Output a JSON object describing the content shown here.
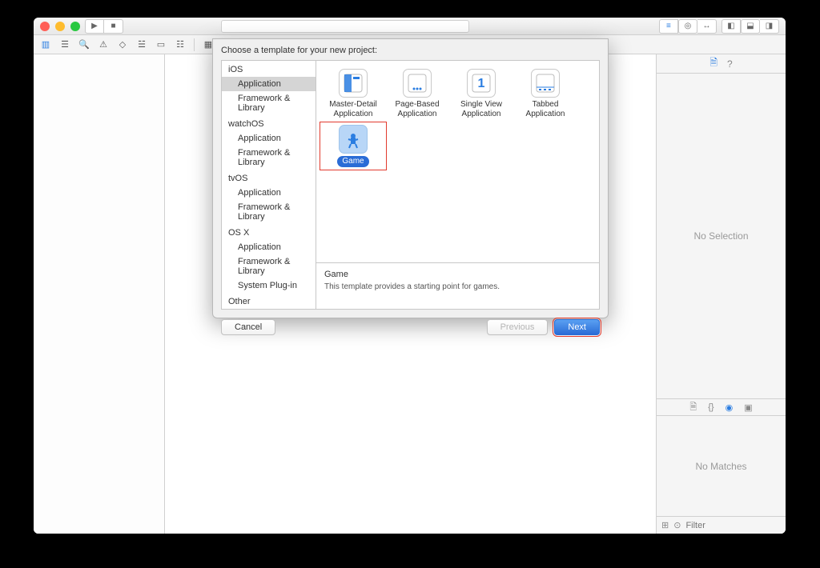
{
  "window": {
    "searchPlaceholder": ""
  },
  "rightPanel": {
    "noSelection": "No Selection",
    "noMatches": "No Matches",
    "filterPlaceholder": "Filter"
  },
  "sheet": {
    "title": "Choose a template for your new project:",
    "categories": [
      {
        "label": "iOS",
        "type": "head"
      },
      {
        "label": "Application",
        "type": "sub",
        "selected": true
      },
      {
        "label": "Framework & Library",
        "type": "sub"
      },
      {
        "label": "watchOS",
        "type": "head"
      },
      {
        "label": "Application",
        "type": "sub"
      },
      {
        "label": "Framework & Library",
        "type": "sub"
      },
      {
        "label": "tvOS",
        "type": "head"
      },
      {
        "label": "Application",
        "type": "sub"
      },
      {
        "label": "Framework & Library",
        "type": "sub"
      },
      {
        "label": "OS X",
        "type": "head"
      },
      {
        "label": "Application",
        "type": "sub"
      },
      {
        "label": "Framework & Library",
        "type": "sub"
      },
      {
        "label": "System Plug-in",
        "type": "sub"
      },
      {
        "label": "Other",
        "type": "head"
      }
    ],
    "templates": [
      {
        "label": "Master-Detail Application",
        "icon": "master-detail"
      },
      {
        "label": "Page-Based Application",
        "icon": "page-based"
      },
      {
        "label": "Single View Application",
        "icon": "single-view"
      },
      {
        "label": "Tabbed Application",
        "icon": "tabbed"
      },
      {
        "label": "Game",
        "icon": "game",
        "selected": true,
        "highlight": true
      }
    ],
    "desc": {
      "title": "Game",
      "text": "This template provides a starting point for games."
    },
    "buttons": {
      "cancel": "Cancel",
      "previous": "Previous",
      "next": "Next"
    }
  }
}
